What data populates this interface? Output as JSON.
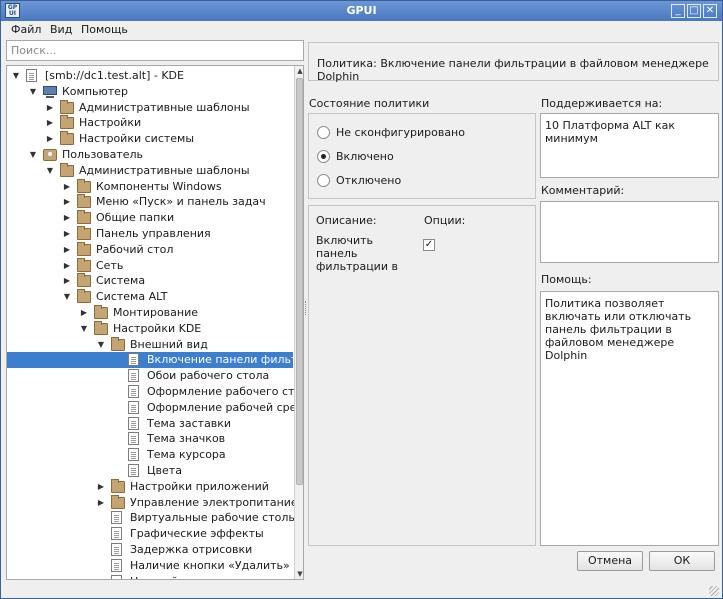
{
  "window": {
    "title": "GPUI",
    "app_icon_text": "GP UI",
    "controls": {
      "minimize": "_",
      "maximize": "□",
      "close": "✕"
    }
  },
  "menu": {
    "file": "Файл",
    "view": "Вид",
    "help": "Помощь"
  },
  "search": {
    "placeholder": "Поиск..."
  },
  "tree": {
    "items": [
      {
        "label": "[smb://dc1.test.alt] - KDE",
        "depth": 0,
        "state": "expanded",
        "icon": "doc-icon"
      },
      {
        "label": "Компьютер",
        "depth": 1,
        "state": "expanded",
        "icon": "computer-icon"
      },
      {
        "label": "Административные шаблоны",
        "depth": 2,
        "state": "collapsed",
        "icon": "folder-icon"
      },
      {
        "label": "Настройки",
        "depth": 2,
        "state": "collapsed",
        "icon": "folder-icon"
      },
      {
        "label": "Настройки системы",
        "depth": 2,
        "state": "collapsed",
        "icon": "folder-icon"
      },
      {
        "label": "Пользователь",
        "depth": 1,
        "state": "expanded",
        "icon": "user-icon"
      },
      {
        "label": "Административные шаблоны",
        "depth": 2,
        "state": "expanded",
        "icon": "folder-icon"
      },
      {
        "label": "Компоненты Windows",
        "depth": 3,
        "state": "collapsed",
        "icon": "folder-icon"
      },
      {
        "label": "Меню «Пуск» и панель задач",
        "depth": 3,
        "state": "collapsed",
        "icon": "folder-icon"
      },
      {
        "label": "Общие папки",
        "depth": 3,
        "state": "collapsed",
        "icon": "folder-icon"
      },
      {
        "label": "Панель управления",
        "depth": 3,
        "state": "collapsed",
        "icon": "folder-icon"
      },
      {
        "label": "Рабочий стол",
        "depth": 3,
        "state": "collapsed",
        "icon": "folder-icon"
      },
      {
        "label": "Сеть",
        "depth": 3,
        "state": "collapsed",
        "icon": "folder-icon"
      },
      {
        "label": "Система",
        "depth": 3,
        "state": "collapsed",
        "icon": "folder-icon"
      },
      {
        "label": "Система ALT",
        "depth": 3,
        "state": "expanded",
        "icon": "folder-icon"
      },
      {
        "label": "Монтирование",
        "depth": 4,
        "state": "collapsed",
        "icon": "folder-icon"
      },
      {
        "label": "Настройки KDE",
        "depth": 4,
        "state": "expanded",
        "icon": "folder-icon"
      },
      {
        "label": "Внешний вид",
        "depth": 5,
        "state": "expanded",
        "icon": "folder-icon"
      },
      {
        "label": "Включение панели фильтр...",
        "depth": 6,
        "state": "leaf",
        "icon": "doc-icon",
        "selected": true
      },
      {
        "label": "Обои рабочего стола",
        "depth": 6,
        "state": "leaf",
        "icon": "doc-icon"
      },
      {
        "label": "Оформление рабочего стола",
        "depth": 6,
        "state": "leaf",
        "icon": "doc-icon"
      },
      {
        "label": "Оформление рабочей среды",
        "depth": 6,
        "state": "leaf",
        "icon": "doc-icon"
      },
      {
        "label": "Тема заставки",
        "depth": 6,
        "state": "leaf",
        "icon": "doc-icon"
      },
      {
        "label": "Тема значков",
        "depth": 6,
        "state": "leaf",
        "icon": "doc-icon"
      },
      {
        "label": "Тема курсора",
        "depth": 6,
        "state": "leaf",
        "icon": "doc-icon"
      },
      {
        "label": "Цвета",
        "depth": 6,
        "state": "leaf",
        "icon": "doc-icon"
      },
      {
        "label": "Настройки приложений",
        "depth": 5,
        "state": "collapsed",
        "icon": "folder-icon"
      },
      {
        "label": "Управление электропитанием",
        "depth": 5,
        "state": "collapsed",
        "icon": "folder-icon"
      },
      {
        "label": "Виртуальные рабочие столы",
        "depth": 5,
        "state": "leaf",
        "icon": "doc-icon"
      },
      {
        "label": "Графические эффекты",
        "depth": 5,
        "state": "leaf",
        "icon": "doc-icon"
      },
      {
        "label": "Задержка отрисовки",
        "depth": 5,
        "state": "leaf",
        "icon": "doc-icon"
      },
      {
        "label": "Наличие кнопки «Удалить» в к...",
        "depth": 5,
        "state": "leaf",
        "icon": "doc-icon"
      },
      {
        "label": "Настройка поискового устр...",
        "depth": 5,
        "state": "leaf",
        "icon": "doc-icon"
      }
    ]
  },
  "policy": {
    "title": "Политика: Включение панели фильтрации в файловом менеджере Dolphin",
    "state_label": "Состояние политики",
    "options": [
      {
        "label": "Не сконфигурировано",
        "checked": false
      },
      {
        "label": "Включено",
        "checked": true
      },
      {
        "label": "Отключено",
        "checked": false
      }
    ],
    "description_label": "Описание:",
    "options_label": "Опции:",
    "option_text": "Включить панель фильтрации в",
    "option_checked": true,
    "supported_label": "Поддерживается на:",
    "supported_value": "10 Платформа ALT как минимум",
    "comment_label": "Комментарий:",
    "comment_value": "",
    "help_label": "Помощь:",
    "help_text": "Политика позволяет включать или отключать панель фильтрации в файловом менеджере Dolphin"
  },
  "buttons": {
    "cancel": "Отмена",
    "ok": "ОК"
  },
  "colors": {
    "selection": "#3b7fce",
    "titlebar": "#5a87c9"
  }
}
